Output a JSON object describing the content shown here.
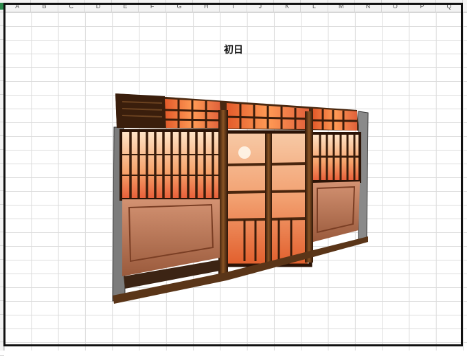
{
  "columns": [
    "A",
    "B",
    "C",
    "D",
    "E",
    "F",
    "G",
    "H",
    "I",
    "J",
    "K",
    "L",
    "M",
    "N",
    "O",
    "P",
    "Q"
  ],
  "sheet": {
    "title": "初日"
  },
  "illustration": {
    "name": "storefront-illustration",
    "colors": {
      "wood_dark": "#3b1f0e",
      "wood_mid": "#7a4a1f",
      "glow_orange": "#f07a3a",
      "glow_light": "#ffd2a8",
      "plaster": "#c98a66",
      "stone": "#8c8c8c"
    }
  }
}
